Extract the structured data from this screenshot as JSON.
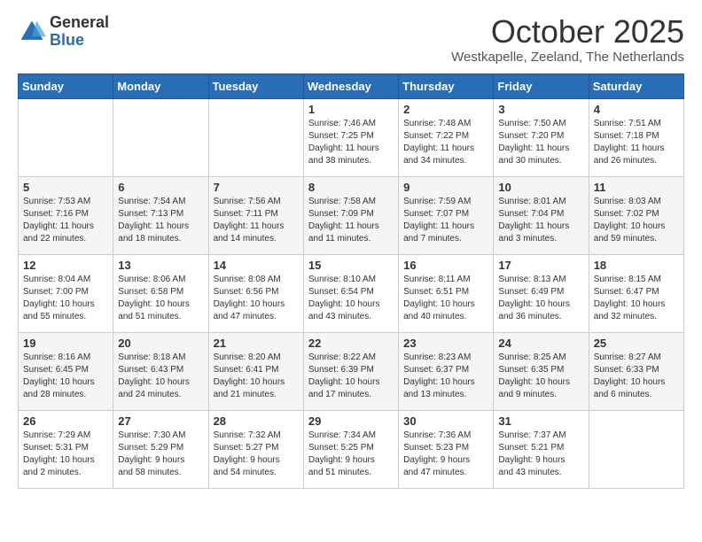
{
  "header": {
    "logo_general": "General",
    "logo_blue": "Blue",
    "month_title": "October 2025",
    "location": "Westkapelle, Zeeland, The Netherlands"
  },
  "weekdays": [
    "Sunday",
    "Monday",
    "Tuesday",
    "Wednesday",
    "Thursday",
    "Friday",
    "Saturday"
  ],
  "weeks": [
    [
      {
        "day": "",
        "info": ""
      },
      {
        "day": "",
        "info": ""
      },
      {
        "day": "",
        "info": ""
      },
      {
        "day": "1",
        "info": "Sunrise: 7:46 AM\nSunset: 7:25 PM\nDaylight: 11 hours\nand 38 minutes."
      },
      {
        "day": "2",
        "info": "Sunrise: 7:48 AM\nSunset: 7:22 PM\nDaylight: 11 hours\nand 34 minutes."
      },
      {
        "day": "3",
        "info": "Sunrise: 7:50 AM\nSunset: 7:20 PM\nDaylight: 11 hours\nand 30 minutes."
      },
      {
        "day": "4",
        "info": "Sunrise: 7:51 AM\nSunset: 7:18 PM\nDaylight: 11 hours\nand 26 minutes."
      }
    ],
    [
      {
        "day": "5",
        "info": "Sunrise: 7:53 AM\nSunset: 7:16 PM\nDaylight: 11 hours\nand 22 minutes."
      },
      {
        "day": "6",
        "info": "Sunrise: 7:54 AM\nSunset: 7:13 PM\nDaylight: 11 hours\nand 18 minutes."
      },
      {
        "day": "7",
        "info": "Sunrise: 7:56 AM\nSunset: 7:11 PM\nDaylight: 11 hours\nand 14 minutes."
      },
      {
        "day": "8",
        "info": "Sunrise: 7:58 AM\nSunset: 7:09 PM\nDaylight: 11 hours\nand 11 minutes."
      },
      {
        "day": "9",
        "info": "Sunrise: 7:59 AM\nSunset: 7:07 PM\nDaylight: 11 hours\nand 7 minutes."
      },
      {
        "day": "10",
        "info": "Sunrise: 8:01 AM\nSunset: 7:04 PM\nDaylight: 11 hours\nand 3 minutes."
      },
      {
        "day": "11",
        "info": "Sunrise: 8:03 AM\nSunset: 7:02 PM\nDaylight: 10 hours\nand 59 minutes."
      }
    ],
    [
      {
        "day": "12",
        "info": "Sunrise: 8:04 AM\nSunset: 7:00 PM\nDaylight: 10 hours\nand 55 minutes."
      },
      {
        "day": "13",
        "info": "Sunrise: 8:06 AM\nSunset: 6:58 PM\nDaylight: 10 hours\nand 51 minutes."
      },
      {
        "day": "14",
        "info": "Sunrise: 8:08 AM\nSunset: 6:56 PM\nDaylight: 10 hours\nand 47 minutes."
      },
      {
        "day": "15",
        "info": "Sunrise: 8:10 AM\nSunset: 6:54 PM\nDaylight: 10 hours\nand 43 minutes."
      },
      {
        "day": "16",
        "info": "Sunrise: 8:11 AM\nSunset: 6:51 PM\nDaylight: 10 hours\nand 40 minutes."
      },
      {
        "day": "17",
        "info": "Sunrise: 8:13 AM\nSunset: 6:49 PM\nDaylight: 10 hours\nand 36 minutes."
      },
      {
        "day": "18",
        "info": "Sunrise: 8:15 AM\nSunset: 6:47 PM\nDaylight: 10 hours\nand 32 minutes."
      }
    ],
    [
      {
        "day": "19",
        "info": "Sunrise: 8:16 AM\nSunset: 6:45 PM\nDaylight: 10 hours\nand 28 minutes."
      },
      {
        "day": "20",
        "info": "Sunrise: 8:18 AM\nSunset: 6:43 PM\nDaylight: 10 hours\nand 24 minutes."
      },
      {
        "day": "21",
        "info": "Sunrise: 8:20 AM\nSunset: 6:41 PM\nDaylight: 10 hours\nand 21 minutes."
      },
      {
        "day": "22",
        "info": "Sunrise: 8:22 AM\nSunset: 6:39 PM\nDaylight: 10 hours\nand 17 minutes."
      },
      {
        "day": "23",
        "info": "Sunrise: 8:23 AM\nSunset: 6:37 PM\nDaylight: 10 hours\nand 13 minutes."
      },
      {
        "day": "24",
        "info": "Sunrise: 8:25 AM\nSunset: 6:35 PM\nDaylight: 10 hours\nand 9 minutes."
      },
      {
        "day": "25",
        "info": "Sunrise: 8:27 AM\nSunset: 6:33 PM\nDaylight: 10 hours\nand 6 minutes."
      }
    ],
    [
      {
        "day": "26",
        "info": "Sunrise: 7:29 AM\nSunset: 5:31 PM\nDaylight: 10 hours\nand 2 minutes."
      },
      {
        "day": "27",
        "info": "Sunrise: 7:30 AM\nSunset: 5:29 PM\nDaylight: 9 hours\nand 58 minutes."
      },
      {
        "day": "28",
        "info": "Sunrise: 7:32 AM\nSunset: 5:27 PM\nDaylight: 9 hours\nand 54 minutes."
      },
      {
        "day": "29",
        "info": "Sunrise: 7:34 AM\nSunset: 5:25 PM\nDaylight: 9 hours\nand 51 minutes."
      },
      {
        "day": "30",
        "info": "Sunrise: 7:36 AM\nSunset: 5:23 PM\nDaylight: 9 hours\nand 47 minutes."
      },
      {
        "day": "31",
        "info": "Sunrise: 7:37 AM\nSunset: 5:21 PM\nDaylight: 9 hours\nand 43 minutes."
      },
      {
        "day": "",
        "info": ""
      }
    ]
  ]
}
